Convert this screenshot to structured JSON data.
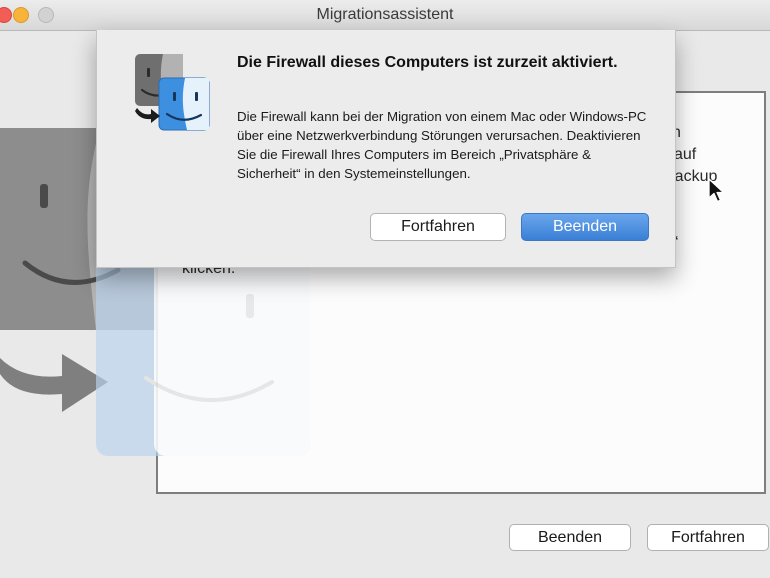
{
  "window": {
    "title": "Migrationsassistent"
  },
  "background": {
    "partial_lines": [
      "n",
      "auf",
      "Backup",
      "n“",
      "klicken."
    ],
    "buttons": {
      "quit_label": "Beenden",
      "continue_label": "Fortfahren"
    }
  },
  "alert": {
    "icon": "migration-assistant-finder-icon",
    "title": "Die Firewall dieses Computers ist zurzeit aktiviert.",
    "body": "Die Firewall kann bei der Migration von einem Mac oder Windows-PC über eine Netzwerkverbindung Störungen verursachen. Deaktivieren Sie die Firewall Ihres Computers im Bereich „Privatsphäre & Sicherheit“ in den Systemeinstellungen.",
    "buttons": {
      "continue_label": "Fortfahren",
      "quit_label": "Beenden"
    }
  },
  "colors": {
    "default_button": "#3a7fd6",
    "close": "#f25d55",
    "minimize": "#f7b33a",
    "zoom": "#d2d2d2"
  }
}
